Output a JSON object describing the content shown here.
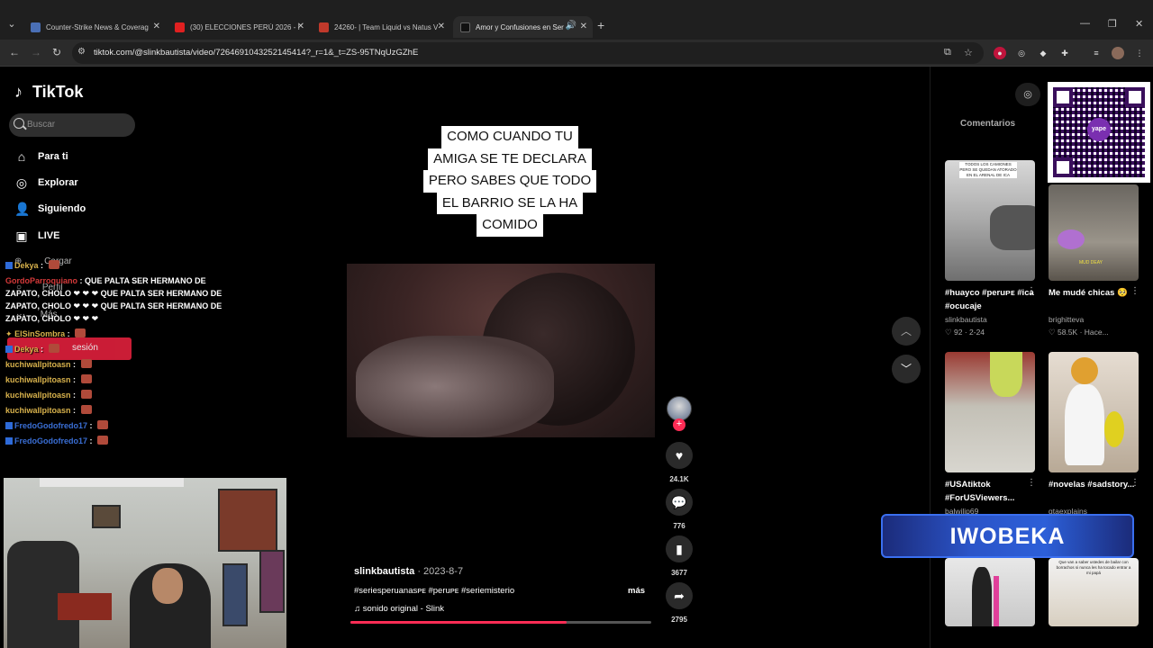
{
  "browser": {
    "tabs": [
      {
        "title": "Counter-Strike News & Coverag",
        "favicon_color": "#4a6fb5"
      },
      {
        "title": "(30) ELECCIONES PERÚ 2026 - I",
        "favicon_color": "#e02020"
      },
      {
        "title": "24260- | Team Liquid vs Natus V",
        "favicon_color": "#c0392b"
      },
      {
        "title": "Amor y Confusiones en Ser",
        "favicon_color": "#111111"
      }
    ],
    "url": "tiktok.com/@slinkbautista/video/7264691043252145414?_r=1&_t=ZS-95TNqUzGZhE"
  },
  "tiktok": {
    "logo": "TikTok",
    "search_placeholder": "Buscar",
    "nav": [
      {
        "label": "Para ti",
        "icon": "home-icon"
      },
      {
        "label": "Explorar",
        "icon": "compass-icon"
      },
      {
        "label": "Siguiendo",
        "icon": "following-icon"
      },
      {
        "label": "LIVE",
        "icon": "live-icon"
      }
    ],
    "ghost_nav": [
      "Cargar",
      "Perfil",
      "Más"
    ],
    "login_label": "sesión"
  },
  "chat": [
    {
      "user": "Dekya",
      "color": "gold",
      "badge": true,
      "msg": ""
    },
    {
      "user": "GordoParroquiano",
      "color": "red",
      "badge": false,
      "msg": "QUE PALTA SER HERMANO DE ZAPATO, CHOLO ❤ ❤ ❤ QUE PALTA SER HERMANO DE ZAPATO, CHOLO ❤ ❤ ❤ QUE PALTA SER HERMANO DE ZAPATO, CHOLO ❤ ❤ ❤"
    },
    {
      "user": "ElSinSombra",
      "color": "gold",
      "badge": false,
      "msg": ""
    },
    {
      "user": "Dekya",
      "color": "gold",
      "badge": true,
      "msg": ""
    },
    {
      "user": "kuchiwallpitoasn",
      "color": "gold",
      "badge": false,
      "msg": ""
    },
    {
      "user": "kuchiwallpitoasn",
      "color": "gold",
      "badge": false,
      "msg": ""
    },
    {
      "user": "kuchiwallpitoasn",
      "color": "gold",
      "badge": false,
      "msg": ""
    },
    {
      "user": "kuchiwallpitoasn",
      "color": "gold",
      "badge": false,
      "msg": ""
    },
    {
      "user": "FredoGodofredo17",
      "color": "blue",
      "badge": true,
      "msg": ""
    },
    {
      "user": "FredoGodofredo17",
      "color": "blue",
      "badge": true,
      "msg": ""
    }
  ],
  "video": {
    "caption_lines": [
      "COMO CUANDO TU",
      "AMIGA SE TE DECLARA",
      "PERO SABES QUE TODO",
      "EL BARRIO SE LA HA",
      "COMIDO"
    ],
    "author": "slinkbautista",
    "date": "· 2023-8-7",
    "tags": "#seriesperuanasᴘᴇ #peruᴘᴇ #seriemisterio",
    "more": "más",
    "sound": "♫  sonido original - Slink",
    "progress": 0.72,
    "likes": "24.1K",
    "comments": "776",
    "saves": "3677",
    "shares": "2795"
  },
  "right_panel": {
    "title": "Comentarios",
    "qr_label": "yape",
    "banner": "IWOBEKA",
    "thumbs": [
      {
        "title": "#huayco #peruᴘᴇ #ica #ocucaje",
        "user": "slinkbautista",
        "likes": "♡ 92",
        "date": "· 2-24"
      },
      {
        "title": "Me mudé chicas 🥺",
        "user": "brighitteva",
        "likes": "♡ 58.5K",
        "date": "· Hace..."
      },
      {
        "title": "#USAtiktok #ForUSViewers...",
        "user": "balwilip69",
        "likes": "",
        "date": ""
      },
      {
        "title": "#novelas #sadstory...",
        "user": "gtaexplains",
        "likes": "",
        "date": ""
      }
    ],
    "thumb1_overlay": "TODOS LOS CAMIONES PERO SE QUEDAN ATORADO EN EL ARENAL DE ICA",
    "thumb2_overlay": "MUD DEAY",
    "thumb6_overlay": "Que van a saber ustedes de bailar con borrachos si nunca les ha tocado entrar a mi papá"
  }
}
